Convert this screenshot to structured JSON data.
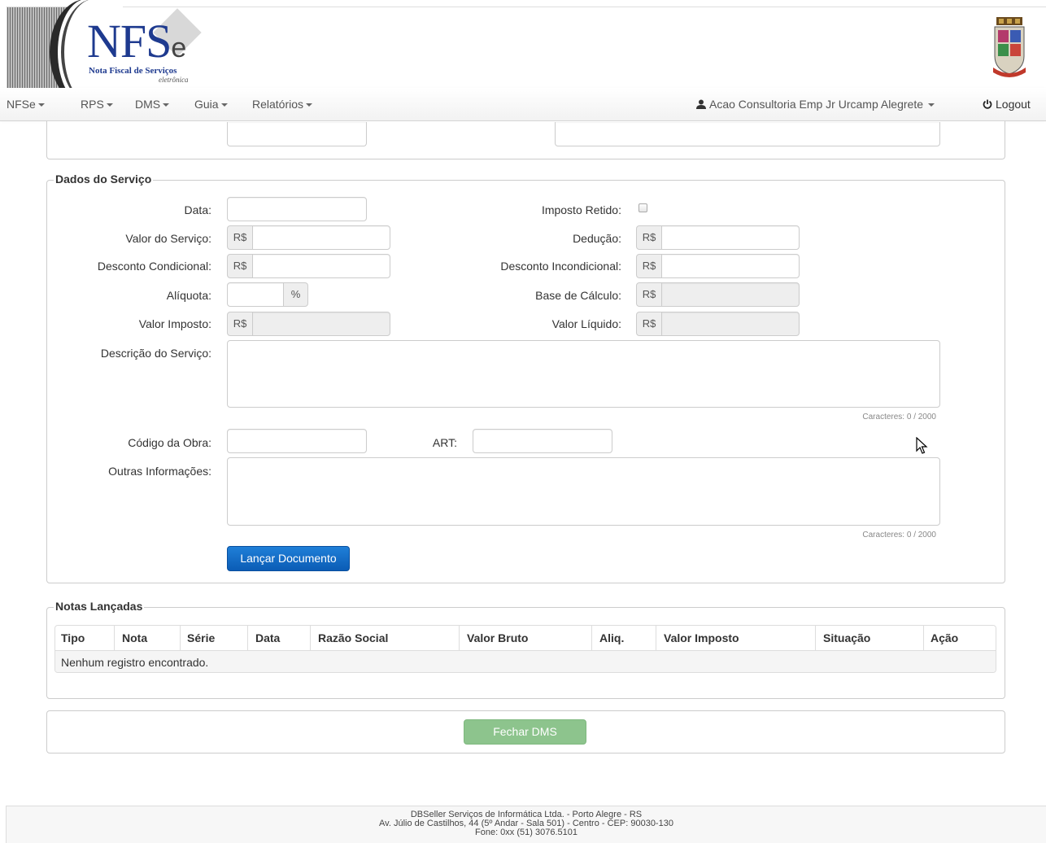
{
  "logo": {
    "main": "NFS",
    "suffix": "e",
    "subtitle": "Nota Fiscal de Serviços",
    "subtitle2": "eletrônica"
  },
  "nav": {
    "items": [
      "NFSe",
      "RPS",
      "DMS",
      "Guia",
      "Relatórios"
    ],
    "user": "Acao Consultoria Emp Jr Urcamp Alegrete",
    "logout": "Logout"
  },
  "servico": {
    "legend": "Dados do Serviço",
    "labels": {
      "data": "Data:",
      "valor_servico": "Valor do Serviço:",
      "desconto_cond": "Desconto Condicional:",
      "aliquota": "Alíquota:",
      "valor_imposto": "Valor Imposto:",
      "descricao": "Descrição do Serviço:",
      "codigo_obra": "Código da Obra:",
      "art": "ART:",
      "outras": "Outras Informações:",
      "imposto_retido": "Imposto Retido:",
      "deducao": "Dedução:",
      "desconto_incond": "Desconto Incondicional:",
      "base_calculo": "Base de Cálculo:",
      "valor_liquido": "Valor Líquido:"
    },
    "currency": "R$",
    "percent": "%",
    "counter": "Caracteres: 0 / 2000",
    "submit": "Lançar Documento"
  },
  "notas": {
    "legend": "Notas Lançadas",
    "columns": [
      "Tipo",
      "Nota",
      "Série",
      "Data",
      "Razão Social",
      "Valor Bruto",
      "Aliq.",
      "Valor Imposto",
      "Situação",
      "Ação"
    ],
    "empty": "Nenhum registro encontrado."
  },
  "close_button": "Fechar DMS",
  "footer": {
    "line1": "DBSeller Serviços de Informática Ltda. - Porto Alegre - RS",
    "line2": "Av. Júlio de Castilhos, 44 (5º Andar - Sala 501) - Centro - CEP: 90030-130",
    "line3": "Fone: 0xx (51) 3076.5101"
  },
  "colors": {
    "primary": "#0b5cb5",
    "success_disabled": "#8dc48d",
    "logo_blue": "#1e3a8f"
  }
}
